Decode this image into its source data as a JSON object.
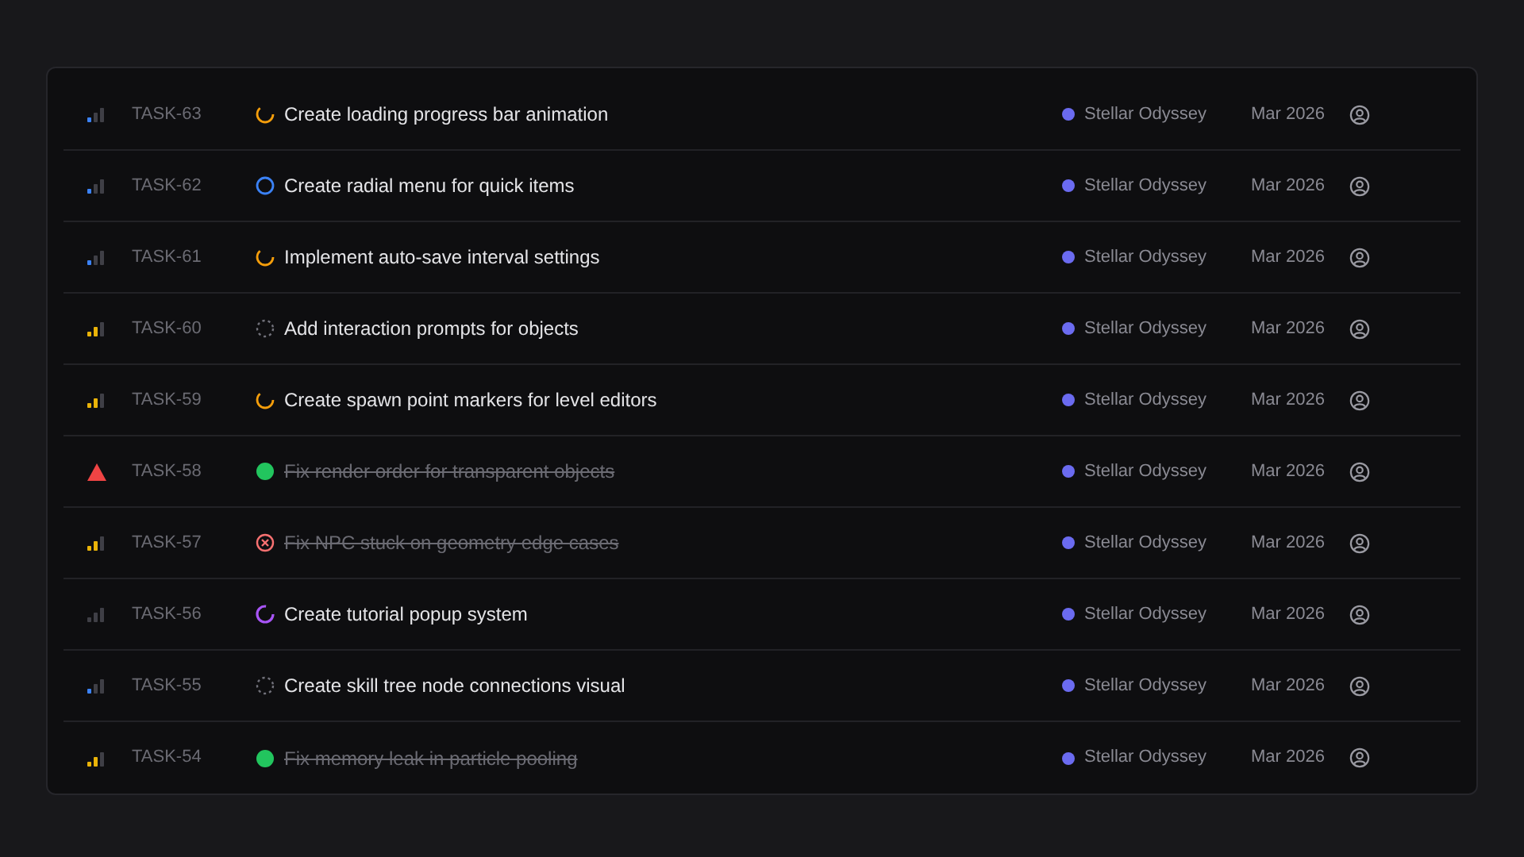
{
  "issues": [
    {
      "priority": {
        "kind": "low"
      },
      "id": "TASK-63",
      "status": {
        "kind": "in_progress"
      },
      "title": "Create loading progress bar animation",
      "project": "Stellar Odyssey",
      "date": "Mar 2026"
    },
    {
      "priority": {
        "kind": "low"
      },
      "id": "TASK-62",
      "status": {
        "kind": "todo"
      },
      "title": "Create radial menu for quick items",
      "project": "Stellar Odyssey",
      "date": "Mar 2026"
    },
    {
      "priority": {
        "kind": "low"
      },
      "id": "TASK-61",
      "status": {
        "kind": "in_progress"
      },
      "title": "Implement auto-save interval settings",
      "project": "Stellar Odyssey",
      "date": "Mar 2026"
    },
    {
      "priority": {
        "kind": "medium"
      },
      "id": "TASK-60",
      "status": {
        "kind": "backlog"
      },
      "title": "Add interaction prompts for objects",
      "project": "Stellar Odyssey",
      "date": "Mar 2026"
    },
    {
      "priority": {
        "kind": "medium"
      },
      "id": "TASK-59",
      "status": {
        "kind": "in_progress"
      },
      "title": "Create spawn point markers for level editors",
      "project": "Stellar Odyssey",
      "date": "Mar 2026"
    },
    {
      "priority": {
        "kind": "urgent"
      },
      "id": "TASK-58",
      "status": {
        "kind": "done"
      },
      "title": "Fix render order for transparent objects",
      "project": "Stellar Odyssey",
      "date": "Mar 2026"
    },
    {
      "priority": {
        "kind": "medium"
      },
      "id": "TASK-57",
      "status": {
        "kind": "canceled"
      },
      "title": "Fix NPC stuck on geometry edge cases",
      "project": "Stellar Odyssey",
      "date": "Mar 2026"
    },
    {
      "priority": {
        "kind": "none"
      },
      "id": "TASK-56",
      "status": {
        "kind": "in_review"
      },
      "title": "Create tutorial popup system",
      "project": "Stellar Odyssey",
      "date": "Mar 2026"
    },
    {
      "priority": {
        "kind": "low"
      },
      "id": "TASK-55",
      "status": {
        "kind": "backlog"
      },
      "title": "Create skill tree node connections visual",
      "project": "Stellar Odyssey",
      "date": "Mar 2026"
    },
    {
      "priority": {
        "kind": "medium"
      },
      "id": "TASK-54",
      "status": {
        "kind": "done"
      },
      "title": "Fix memory leak in particle pooling",
      "project": "Stellar Odyssey",
      "date": "Mar 2026"
    }
  ]
}
